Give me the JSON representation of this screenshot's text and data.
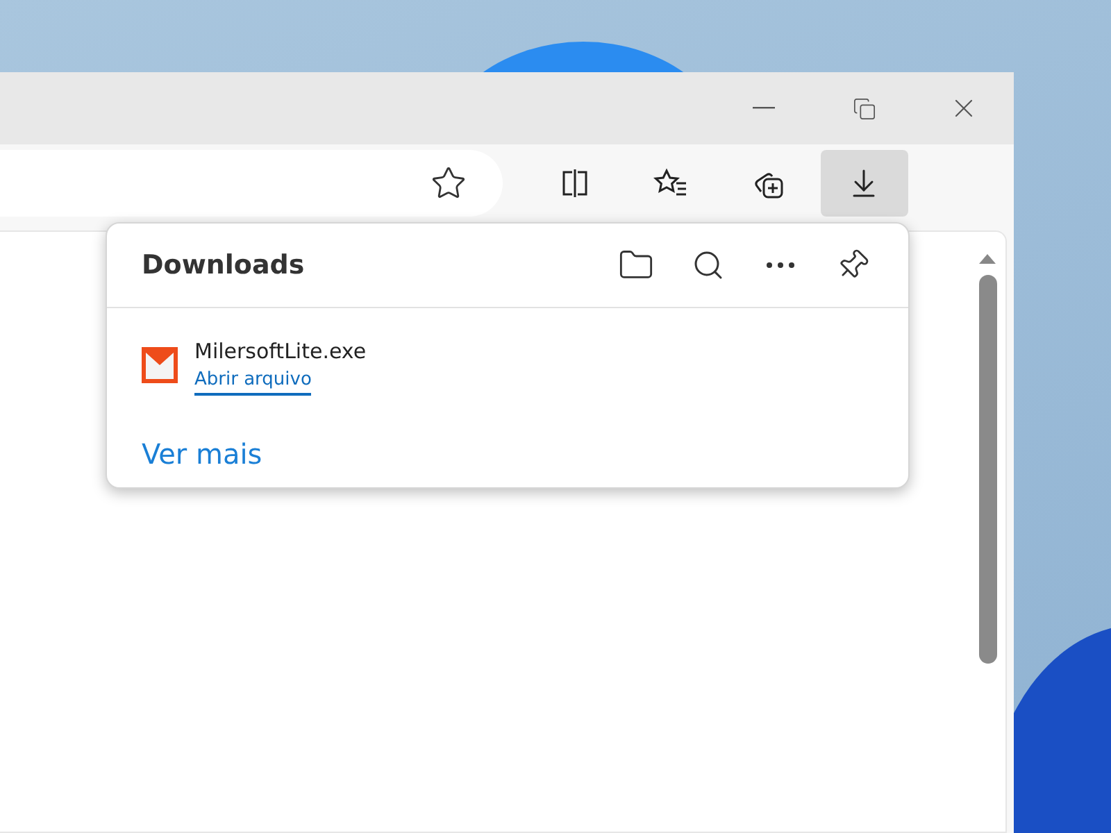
{
  "toolbar_buttons": [
    {
      "kind": "split",
      "selected": false
    },
    {
      "kind": "favorites",
      "selected": false
    },
    {
      "kind": "collections",
      "selected": false
    },
    {
      "kind": "downloads",
      "selected": true
    }
  ],
  "downloads_panel": {
    "title": "Downloads",
    "items": [
      {
        "file_name": "MilersoftLite.exe",
        "action": "Abrir arquivo"
      }
    ],
    "more_link": "Ver mais"
  }
}
